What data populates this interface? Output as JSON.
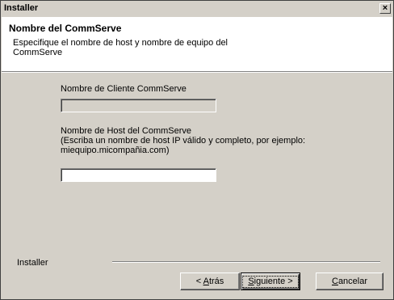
{
  "window": {
    "title": "Installer",
    "close_glyph": "×"
  },
  "header": {
    "title": "Nombre del CommServe",
    "subtitle": "Especifique el nombre de host y nombre de equipo del\nCommServe"
  },
  "form": {
    "client_name_label": "Nombre de Cliente CommServe",
    "client_name_value": "",
    "host_name_label": "Nombre de Host del CommServe\n(Escriba un nombre de host IP válido y completo, por ejemplo:\nmiequipo.micompañia.com)",
    "host_name_value": ""
  },
  "footer": {
    "brand_label": "Installer"
  },
  "buttons": {
    "back": {
      "prefix": "< ",
      "mnemonic": "A",
      "rest": "trás"
    },
    "next": {
      "mnemonic": "S",
      "rest": "iguiente >"
    },
    "cancel": {
      "mnemonic": "C",
      "rest": "ancelar"
    }
  },
  "colors": {
    "dialog_bg": "#d4d0c8",
    "header_bg": "#ffffff"
  }
}
